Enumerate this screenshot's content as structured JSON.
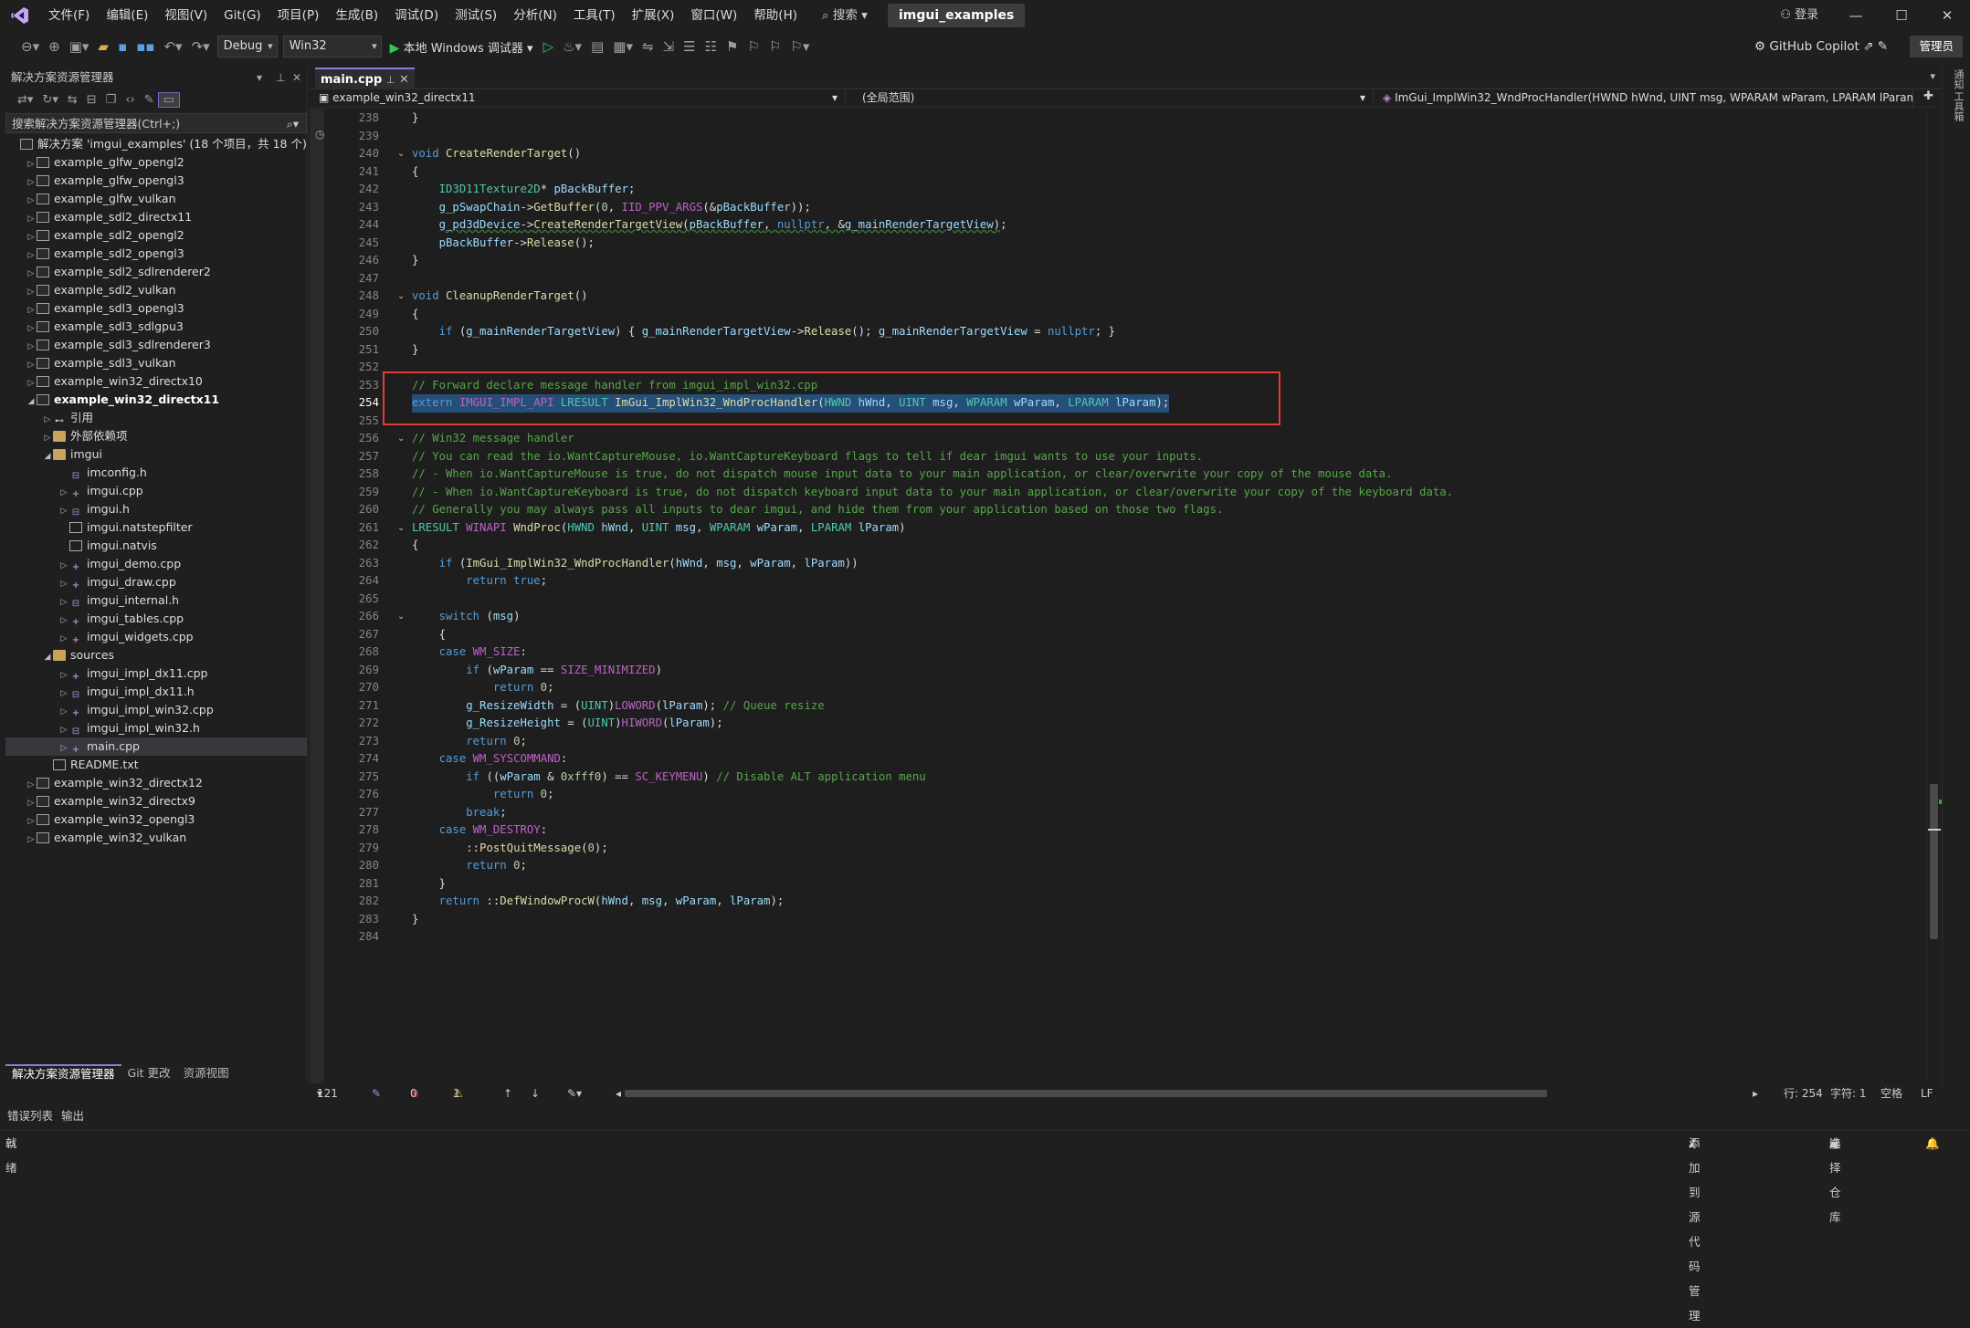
{
  "titlebar": {
    "menus": [
      "文件(F)",
      "编辑(E)",
      "视图(V)",
      "Git(G)",
      "项目(P)",
      "生成(B)",
      "调试(D)",
      "测试(S)",
      "分析(N)",
      "工具(T)",
      "扩展(X)",
      "窗口(W)",
      "帮助(H)"
    ],
    "search": "搜索",
    "solution_name": "imgui_examples",
    "login": "登录"
  },
  "toolbar": {
    "config": "Debug",
    "platform": "Win32",
    "run": "本地 Windows 调试器",
    "copilot": "GitHub Copilot",
    "admin": "管理员"
  },
  "solution_explorer": {
    "title": "解决方案资源管理器",
    "search_placeholder": "搜索解决方案资源管理器(Ctrl+;)",
    "tree": [
      {
        "label": "解决方案 'imgui_examples' (18 个项目，共 18 个)",
        "depth": 0,
        "type": "solution",
        "twisty": ""
      },
      {
        "label": "example_glfw_opengl2",
        "depth": 1,
        "type": "proj",
        "twisty": "▷"
      },
      {
        "label": "example_glfw_opengl3",
        "depth": 1,
        "type": "proj",
        "twisty": "▷"
      },
      {
        "label": "example_glfw_vulkan",
        "depth": 1,
        "type": "proj",
        "twisty": "▷"
      },
      {
        "label": "example_sdl2_directx11",
        "depth": 1,
        "type": "proj",
        "twisty": "▷"
      },
      {
        "label": "example_sdl2_opengl2",
        "depth": 1,
        "type": "proj",
        "twisty": "▷"
      },
      {
        "label": "example_sdl2_opengl3",
        "depth": 1,
        "type": "proj",
        "twisty": "▷"
      },
      {
        "label": "example_sdl2_sdlrenderer2",
        "depth": 1,
        "type": "proj",
        "twisty": "▷"
      },
      {
        "label": "example_sdl2_vulkan",
        "depth": 1,
        "type": "proj",
        "twisty": "▷"
      },
      {
        "label": "example_sdl3_opengl3",
        "depth": 1,
        "type": "proj",
        "twisty": "▷"
      },
      {
        "label": "example_sdl3_sdlgpu3",
        "depth": 1,
        "type": "proj",
        "twisty": "▷"
      },
      {
        "label": "example_sdl3_sdlrenderer3",
        "depth": 1,
        "type": "proj",
        "twisty": "▷"
      },
      {
        "label": "example_sdl3_vulkan",
        "depth": 1,
        "type": "proj",
        "twisty": "▷"
      },
      {
        "label": "example_win32_directx10",
        "depth": 1,
        "type": "proj",
        "twisty": "▷"
      },
      {
        "label": "example_win32_directx11",
        "depth": 1,
        "type": "proj",
        "twisty": "◢",
        "bold": true
      },
      {
        "label": "引用",
        "depth": 2,
        "type": "ref",
        "twisty": "▷"
      },
      {
        "label": "外部依赖项",
        "depth": 2,
        "type": "folder",
        "twisty": "▷"
      },
      {
        "label": "imgui",
        "depth": 2,
        "type": "folder",
        "twisty": "◢"
      },
      {
        "label": "imconfig.h",
        "depth": 3,
        "type": "h",
        "twisty": ""
      },
      {
        "label": "imgui.cpp",
        "depth": 3,
        "type": "cpp",
        "twisty": "▷"
      },
      {
        "label": "imgui.h",
        "depth": 3,
        "type": "h",
        "twisty": "▷"
      },
      {
        "label": "imgui.natstepfilter",
        "depth": 3,
        "type": "file",
        "twisty": ""
      },
      {
        "label": "imgui.natvis",
        "depth": 3,
        "type": "file",
        "twisty": ""
      },
      {
        "label": "imgui_demo.cpp",
        "depth": 3,
        "type": "cpp",
        "twisty": "▷"
      },
      {
        "label": "imgui_draw.cpp",
        "depth": 3,
        "type": "cpp",
        "twisty": "▷"
      },
      {
        "label": "imgui_internal.h",
        "depth": 3,
        "type": "h",
        "twisty": "▷"
      },
      {
        "label": "imgui_tables.cpp",
        "depth": 3,
        "type": "cpp",
        "twisty": "▷"
      },
      {
        "label": "imgui_widgets.cpp",
        "depth": 3,
        "type": "cpp",
        "twisty": "▷"
      },
      {
        "label": "sources",
        "depth": 2,
        "type": "folder",
        "twisty": "◢"
      },
      {
        "label": "imgui_impl_dx11.cpp",
        "depth": 3,
        "type": "cpp",
        "twisty": "▷"
      },
      {
        "label": "imgui_impl_dx11.h",
        "depth": 3,
        "type": "h",
        "twisty": "▷"
      },
      {
        "label": "imgui_impl_win32.cpp",
        "depth": 3,
        "type": "cpp",
        "twisty": "▷"
      },
      {
        "label": "imgui_impl_win32.h",
        "depth": 3,
        "type": "h",
        "twisty": "▷"
      },
      {
        "label": "main.cpp",
        "depth": 3,
        "type": "cpp",
        "twisty": "▷",
        "selected": true
      },
      {
        "label": "README.txt",
        "depth": 2,
        "type": "file",
        "twisty": ""
      },
      {
        "label": "example_win32_directx12",
        "depth": 1,
        "type": "proj",
        "twisty": "▷"
      },
      {
        "label": "example_win32_directx9",
        "depth": 1,
        "type": "proj",
        "twisty": "▷"
      },
      {
        "label": "example_win32_opengl3",
        "depth": 1,
        "type": "proj",
        "twisty": "▷"
      },
      {
        "label": "example_win32_vulkan",
        "depth": 1,
        "type": "proj",
        "twisty": "▷"
      }
    ],
    "tabs": [
      "解决方案资源管理器",
      "Git 更改",
      "资源视图"
    ]
  },
  "editor": {
    "tab": "main.cpp",
    "nav_project": "example_win32_directx11",
    "nav_scope": "(全局范围)",
    "nav_member": "ImGui_ImplWin32_WndProcHandler(HWND hWnd, UINT msg, WPARAM wParam, LPARAM lParam)",
    "current_line": 254,
    "lines": [
      {
        "n": 238,
        "html": "}"
      },
      {
        "n": 239,
        "html": ""
      },
      {
        "n": 240,
        "html": "<span class='k'>void</span> <span class='f'>CreateRenderTarget</span>()",
        "fold": true
      },
      {
        "n": 241,
        "html": "{"
      },
      {
        "n": 242,
        "html": "    <span class='t'>ID3D11Texture2D</span>* <span class='v'>pBackBuffer</span>;"
      },
      {
        "n": 243,
        "html": "    <span class='v'>g_pSwapChain</span>-><span class='f'>GetBuffer</span>(<span class='n'>0</span>, <span class='m'>IID_PPV_ARGS</span>(&amp;<span class='v'>pBackBuffer</span>));"
      },
      {
        "n": 244,
        "html": "    <span class='sq'><span class='v'>g_pd3dDevice</span>-><span class='f'>CreateRenderTargetView</span>(<span class='v'>pBackBuffer</span>, <span class='k'>nullptr</span>, &amp;<span class='v'>g_mainRenderTargetView</span>)</span>;"
      },
      {
        "n": 245,
        "html": "    <span class='v'>pBackBuffer</span>-><span class='f'>Release</span>();"
      },
      {
        "n": 246,
        "html": "}"
      },
      {
        "n": 247,
        "html": ""
      },
      {
        "n": 248,
        "html": "<span class='k'>void</span> <span class='f'>CleanupRenderTarget</span>()",
        "fold": true
      },
      {
        "n": 249,
        "html": "{"
      },
      {
        "n": 250,
        "html": "    <span class='k'>if</span> (<span class='v'>g_mainRenderTargetView</span>) { <span class='v'>g_mainRenderTargetView</span>-><span class='f'>Release</span>(); <span class='v'>g_mainRenderTargetView</span> = <span class='k'>nullptr</span>; }"
      },
      {
        "n": 251,
        "html": "}"
      },
      {
        "n": 252,
        "html": ""
      },
      {
        "n": 253,
        "html": "<span class='c'>// Forward declare message handler from imgui_impl_win32.cpp</span>"
      },
      {
        "n": 254,
        "html": "<span class='k'>extern</span> <span class='m'>IMGUI_IMPL_API</span> <span class='t'>LRESULT</span> <span class='f'>ImGui_ImplWin32_WndProcHandler</span>(<span class='t'>HWND</span> <span class='v'>hWnd</span>, <span class='t'>UINT</span> <span class='v'>msg</span>, <span class='t'>WPARAM</span> <span class='v'>wParam</span>, <span class='t'>LPARAM</span> <span class='v'>lParam</span>);"
      },
      {
        "n": 255,
        "html": ""
      },
      {
        "n": 256,
        "html": "<span class='c'>// Win32 message handler</span>",
        "fold": true
      },
      {
        "n": 257,
        "html": "<span class='c'>// You can read the io.WantCaptureMouse, io.WantCaptureKeyboard flags to tell if dear imgui wants to use your inputs.</span>"
      },
      {
        "n": 258,
        "html": "<span class='c'>// - When io.WantCaptureMouse is true, do not dispatch mouse input data to your main application, or clear/overwrite your copy of the mouse data.</span>"
      },
      {
        "n": 259,
        "html": "<span class='c'>// - When io.WantCaptureKeyboard is true, do not dispatch keyboard input data to your main application, or clear/overwrite your copy of the keyboard data.</span>"
      },
      {
        "n": 260,
        "html": "<span class='c'>// Generally you may always pass all inputs to dear imgui, and hide them from your application based on those two flags.</span>"
      },
      {
        "n": 261,
        "html": "<span class='t'>LRESULT</span> <span class='m'>WINAPI</span> <span class='f'>WndProc</span>(<span class='t'>HWND</span> <span class='v'>hWnd</span>, <span class='t'>UINT</span> <span class='v'>msg</span>, <span class='t'>WPARAM</span> <span class='v'>wParam</span>, <span class='t'>LPARAM</span> <span class='v'>lParam</span>)",
        "fold": true
      },
      {
        "n": 262,
        "html": "{"
      },
      {
        "n": 263,
        "html": "    <span class='k'>if</span> (<span class='f'>ImGui_ImplWin32_WndProcHandler</span>(<span class='v'>hWnd</span>, <span class='v'>msg</span>, <span class='v'>wParam</span>, <span class='v'>lParam</span>))"
      },
      {
        "n": 264,
        "html": "        <span class='k'>return</span> <span class='k'>true</span>;"
      },
      {
        "n": 265,
        "html": ""
      },
      {
        "n": 266,
        "html": "    <span class='k'>switch</span> (<span class='v'>msg</span>)",
        "fold": true
      },
      {
        "n": 267,
        "html": "    {"
      },
      {
        "n": 268,
        "html": "    <span class='k'>case</span> <span class='m'>WM_SIZE</span>:"
      },
      {
        "n": 269,
        "html": "        <span class='k'>if</span> (<span class='v'>wParam</span> == <span class='m'>SIZE_MINIMIZED</span>)"
      },
      {
        "n": 270,
        "html": "            <span class='k'>return</span> <span class='n'>0</span>;"
      },
      {
        "n": 271,
        "html": "        <span class='v'>g_ResizeWidth</span> = (<span class='t'>UINT</span>)<span class='m'>LOWORD</span>(<span class='v'>lParam</span>); <span class='c'>// Queue resize</span>"
      },
      {
        "n": 272,
        "html": "        <span class='v'>g_ResizeHeight</span> = (<span class='t'>UINT</span>)<span class='m'>HIWORD</span>(<span class='v'>lParam</span>);"
      },
      {
        "n": 273,
        "html": "        <span class='k'>return</span> <span class='n'>0</span>;"
      },
      {
        "n": 274,
        "html": "    <span class='k'>case</span> <span class='m'>WM_SYSCOMMAND</span>:"
      },
      {
        "n": 275,
        "html": "        <span class='k'>if</span> ((<span class='v'>wParam</span> &amp; <span class='n'>0xfff0</span>) == <span class='m'>SC_KEYMENU</span>) <span class='c'>// Disable ALT application menu</span>"
      },
      {
        "n": 276,
        "html": "            <span class='k'>return</span> <span class='n'>0</span>;"
      },
      {
        "n": 277,
        "html": "        <span class='k'>break</span>;"
      },
      {
        "n": 278,
        "html": "    <span class='k'>case</span> <span class='m'>WM_DESTROY</span>:"
      },
      {
        "n": 279,
        "html": "        ::<span class='f'>PostQuitMessage</span>(<span class='n'>0</span>);"
      },
      {
        "n": 280,
        "html": "        <span class='k'>return</span> <span class='n'>0</span>;"
      },
      {
        "n": 281,
        "html": "    }"
      },
      {
        "n": 282,
        "html": "    <span class='k'>return</span> ::<span class='f'>DefWindowProcW</span>(<span class='v'>hWnd</span>, <span class='v'>msg</span>, <span class='v'>wParam</span>, <span class='v'>lParam</span>);"
      },
      {
        "n": 283,
        "html": "}"
      },
      {
        "n": 284,
        "html": ""
      }
    ]
  },
  "editor_status": {
    "zoom": "121 %",
    "errors": "0",
    "warnings": "1",
    "line": "行: 254",
    "col": "字符: 1",
    "whitespace": "空格",
    "eol": "LF"
  },
  "bottom_tabs": [
    "错误列表",
    "输出"
  ],
  "statusbar": {
    "ready": "就绪",
    "add_source": "添加到源代码管理",
    "select_repo": "选择仓库"
  },
  "right_strip": [
    "通知",
    "工具箱"
  ],
  "colors": {
    "accent": "#8b7bd8",
    "selection": "#264f78",
    "highlight_box": "#e53935"
  }
}
